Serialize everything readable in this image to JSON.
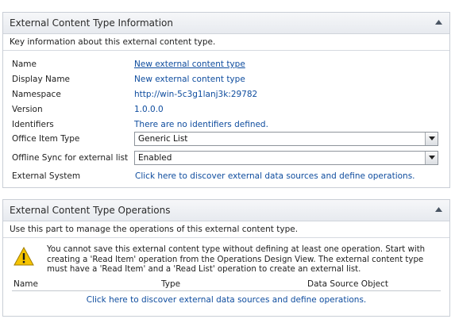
{
  "info_panel": {
    "title": "External Content Type Information",
    "description": "Key information about this external content type.",
    "fields": {
      "name": {
        "label": "Name",
        "value": "New external content type"
      },
      "display_name": {
        "label": "Display Name",
        "value": "New external content type"
      },
      "namespace": {
        "label": "Namespace",
        "value": "http://win-5c3g1lanj3k:29782"
      },
      "version": {
        "label": "Version",
        "value": "1.0.0.0"
      },
      "identifiers": {
        "label": "Identifiers",
        "value": "There are no identifiers defined."
      },
      "office_item_type": {
        "label": "Office Item Type",
        "selected": "Generic List"
      },
      "offline_sync": {
        "label": "Offline Sync for external list",
        "selected": "Enabled"
      },
      "external_system": {
        "label": "External System",
        "value": "Click here to discover external data sources and define operations."
      }
    }
  },
  "ops_panel": {
    "title": "External Content Type Operations",
    "description": "Use this part to manage the operations of this external content type.",
    "warning": "You cannot save this external content type without defining at least one operation. Start with creating a 'Read Item' operation from the Operations Design View. The external content type must have a 'Read Item' and a 'Read List' operation to create an external list.",
    "columns": [
      "Name",
      "Type",
      "Data Source Object"
    ],
    "empty_link": "Click here to discover external data sources and define operations."
  },
  "colors": {
    "link": "#0e4c9e",
    "header_bg": "#e7eaef",
    "border": "#c9ced6",
    "warning_yellow": "#f5c400"
  },
  "icons": [
    "collapse-icon",
    "dropdown-arrow-icon",
    "warning-icon"
  ]
}
